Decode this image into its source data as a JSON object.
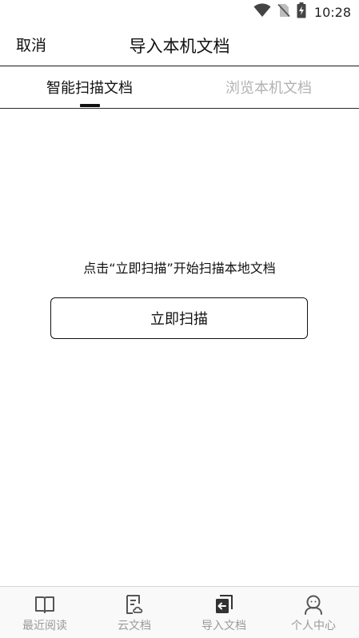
{
  "status_bar": {
    "time": "10:28",
    "icons": [
      "wifi-icon",
      "no-sim-icon",
      "battery-charging-icon"
    ]
  },
  "header": {
    "cancel_label": "取消",
    "title": "导入本机文档"
  },
  "tabs": [
    {
      "label": "智能扫描文档",
      "active": true
    },
    {
      "label": "浏览本机文档",
      "active": false
    }
  ],
  "content": {
    "hint": "点击“立即扫描”开始扫描本地文档",
    "scan_button_label": "立即扫描"
  },
  "bottom_nav": {
    "items": [
      {
        "label": "最近阅读",
        "icon": "open-book-icon"
      },
      {
        "label": "云文档",
        "icon": "cloud-document-icon"
      },
      {
        "label": "导入文档",
        "icon": "import-document-icon"
      },
      {
        "label": "个人中心",
        "icon": "person-icon"
      }
    ]
  },
  "colors": {
    "text_primary": "#111111",
    "tab_inactive": "#b2b2b2",
    "nav_label": "#9a9a9a",
    "nav_background": "#f9f9f9"
  }
}
